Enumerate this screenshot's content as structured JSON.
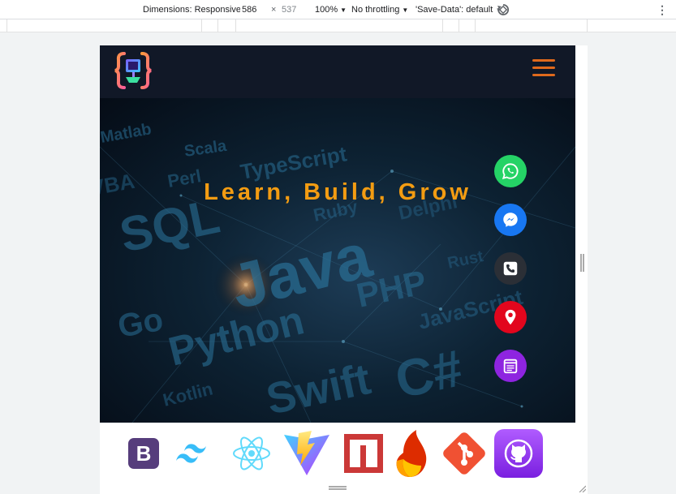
{
  "devtools": {
    "dimensions_label": "Dimensions: Responsive",
    "width_value": "586",
    "times": "×",
    "height_value": "537",
    "zoom": "100%",
    "throttling": "No throttling",
    "save_data": "'Save-Data': default",
    "more": "⋮",
    "icons": [
      "caret-down-icon",
      "rotate-icon",
      "more-vert-icon"
    ]
  },
  "site": {
    "logo_icon": "code-braces-logo",
    "menu_icon": "hamburger-menu-icon",
    "hero": {
      "title": "Learn, Build, Grow",
      "background_words": [
        "Matlab",
        "Scala",
        "Perl",
        "TypeScript",
        "VBA",
        "SQL",
        "Ruby",
        "Delphi",
        "Java",
        "PHP",
        "Rust",
        "Go",
        "Python",
        "JavaScript",
        "Swift",
        "C#",
        "Kotlin"
      ]
    },
    "contact_buttons": [
      {
        "name": "whatsapp",
        "icon": "whatsapp-icon",
        "color": "#25d366"
      },
      {
        "name": "messenger",
        "icon": "messenger-icon",
        "color": "#1877f2"
      },
      {
        "name": "phone",
        "icon": "phone-icon",
        "color": "#2b2f36"
      },
      {
        "name": "location",
        "icon": "map-pin-icon",
        "color": "#e2061d"
      },
      {
        "name": "notes",
        "icon": "notepad-icon",
        "color": "#8e24e0"
      }
    ],
    "tech_logos": [
      {
        "name": "bootstrap",
        "label": "B",
        "color": "#563d7c"
      },
      {
        "name": "tailwind",
        "color": "#38bdf8"
      },
      {
        "name": "react",
        "color": "#61dafb"
      },
      {
        "name": "vite",
        "color": "#bd34fe"
      },
      {
        "name": "npm",
        "color": "#cb3837"
      },
      {
        "name": "firebase",
        "color": "#ffa000"
      },
      {
        "name": "git",
        "color": "#f05133"
      },
      {
        "name": "github",
        "color": "#9b30ff"
      }
    ]
  }
}
